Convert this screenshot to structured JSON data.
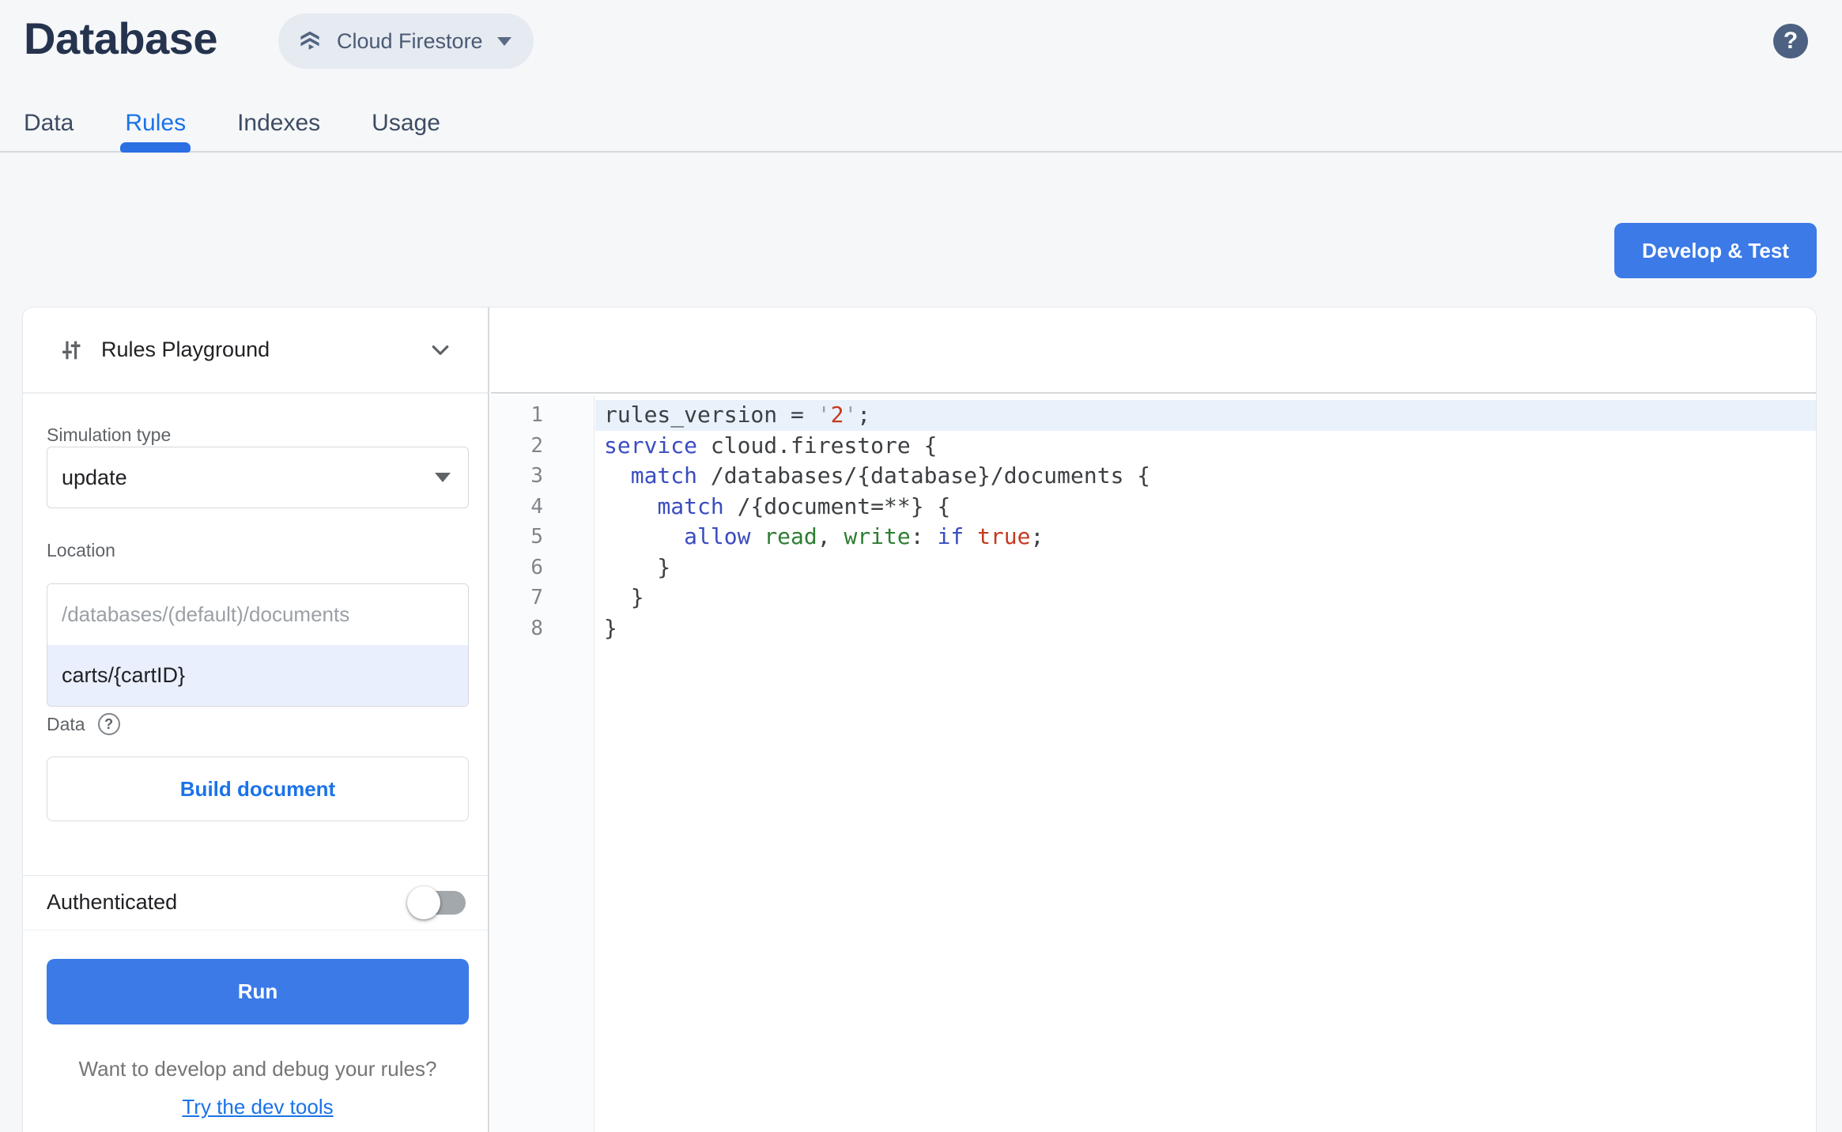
{
  "header": {
    "title": "Database",
    "product_switcher": {
      "label": "Cloud Firestore"
    },
    "help_label": "?"
  },
  "tabs": [
    {
      "label": "Data",
      "active": false
    },
    {
      "label": "Rules",
      "active": true
    },
    {
      "label": "Indexes",
      "active": false
    },
    {
      "label": "Usage",
      "active": false
    }
  ],
  "actions": {
    "develop_test": "Develop & Test"
  },
  "playground": {
    "title": "Rules Playground",
    "simulation_type": {
      "label": "Simulation type",
      "value": "update"
    },
    "location": {
      "label": "Location",
      "prefix": "/databases/(default)/documents",
      "value": "carts/{cartID}"
    },
    "data_section": {
      "label": "Data",
      "build_button": "Build document"
    },
    "auth": {
      "label": "Authenticated",
      "enabled": false
    },
    "run_button": "Run",
    "footer": {
      "question": "Want to develop and debug your rules?",
      "link": "Try the dev tools"
    }
  },
  "editor": {
    "active_line": 1,
    "lines": [
      {
        "n": 1,
        "t": [
          [
            "rules_version = ",
            "d"
          ],
          [
            "'",
            "q"
          ],
          [
            "2",
            "s"
          ],
          [
            "'",
            "q"
          ],
          [
            ";",
            "d"
          ]
        ]
      },
      {
        "n": 2,
        "t": [
          [
            "service",
            "k"
          ],
          [
            " cloud.firestore {",
            "d"
          ]
        ]
      },
      {
        "n": 3,
        "t": [
          [
            "  ",
            "d"
          ],
          [
            "match",
            "k"
          ],
          [
            " /databases/{database}/documents {",
            "d"
          ]
        ]
      },
      {
        "n": 4,
        "t": [
          [
            "    ",
            "d"
          ],
          [
            "match",
            "k"
          ],
          [
            " /{document=**} {",
            "d"
          ]
        ]
      },
      {
        "n": 5,
        "t": [
          [
            "      ",
            "d"
          ],
          [
            "allow",
            "k"
          ],
          [
            " ",
            "d"
          ],
          [
            "read",
            "g"
          ],
          [
            ", ",
            "d"
          ],
          [
            "write",
            "g"
          ],
          [
            ": ",
            "d"
          ],
          [
            "if",
            "k"
          ],
          [
            " ",
            "d"
          ],
          [
            "true",
            "a"
          ],
          [
            ";",
            "d"
          ]
        ]
      },
      {
        "n": 6,
        "t": [
          [
            "    }",
            "d"
          ]
        ]
      },
      {
        "n": 7,
        "t": [
          [
            "  }",
            "d"
          ]
        ]
      },
      {
        "n": 8,
        "t": [
          [
            "}",
            "d"
          ]
        ]
      }
    ]
  },
  "colors": {
    "accent_blue": "#1a73e8",
    "button_blue": "#3b7ae7",
    "title_navy": "#25334e",
    "active_line_bg": "#e9f1fb",
    "location_value_bg": "#e9effc",
    "keyword": "#3a4cc0",
    "string": "#c5391e",
    "identifier_green": "#2e7d32",
    "gutter_text": "#80868b",
    "page_bg": "#f6f7f9"
  }
}
